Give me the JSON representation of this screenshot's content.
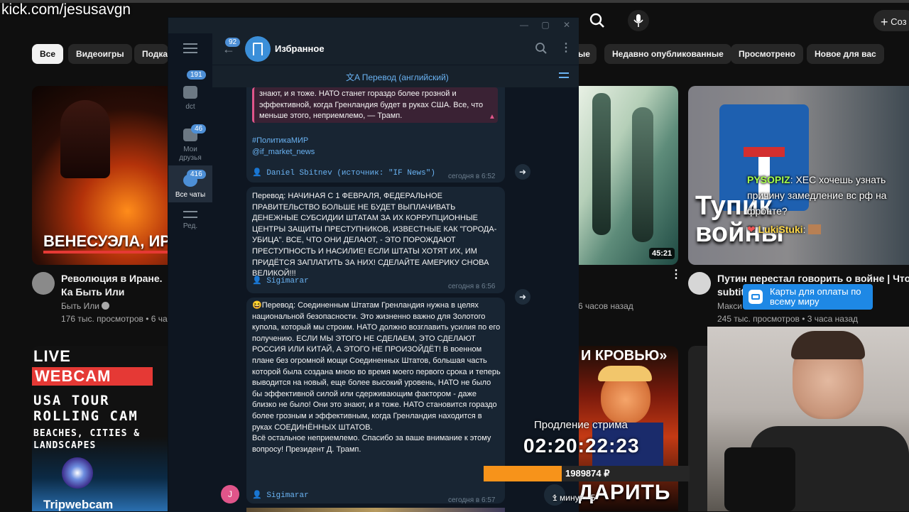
{
  "overlay": {
    "channel_url": "kick.com/jesusavgn",
    "stream_extension_label": "Продление стрима",
    "stream_timer": "02:20:22:23",
    "donation_amount": "1989874 ₽",
    "donation_progress_pct": 38,
    "bottom_timer_text": "1 минут - 5",
    "ad_text": "Карты для оплаты по всему миру",
    "chat": [
      {
        "user": "PYSOPIZ",
        "text": ": ХЕС хочешь узнать причину замедление вс рф на фронте?"
      },
      {
        "user": "LukiStuki",
        "text": ":"
      }
    ]
  },
  "youtube": {
    "create_label": "Соз",
    "chips": [
      "Все",
      "Видеоигры",
      "Подка",
      "ые",
      "Недавно опубликованные",
      "Просмотрено",
      "Новое для вас"
    ],
    "videos": [
      {
        "thumb_text": "ВЕНЕСУЭЛА, ИР",
        "title": "Революция в Иране. Ка Быть Или",
        "channel": "Быть Или",
        "meta": "176 тыс. просмотров • 6 ча"
      },
      {
        "thumb_text": "",
        "duration": "45:21",
        "title": "",
        "channel": "",
        "meta": "6 часов назад"
      },
      {
        "thumb_text": "Тупик войны",
        "title": "Путин перестал говорить о войне | Что слу",
        "channel": "Макси",
        "meta": "245 тыс. просмотров • 3 часа назад",
        "subtitle_fragment": "subtit"
      },
      {
        "thumb_text": "LIVE WEBCAM USA TOUR ROLLING CAM BEACHES, CITIES & LANDSCAPES Tripwebcam",
        "title": "",
        "channel": "",
        "meta": ""
      },
      {
        "thumb_text": "И КРОВЬЮ»",
        "bottom_text": "ДАРИТЬ",
        "title": "",
        "channel": "",
        "meta": ""
      }
    ],
    "live_badge": "LIVE",
    "webcam_label": "WEBCAM",
    "usa_tour": "USA TOUR",
    "rolling_cam": "ROLLING CAM",
    "beaches": "BEACHES, CITIES &",
    "landscapes": "LANDSCAPES",
    "tripwebcam": "Tripwebcam"
  },
  "telegram": {
    "back_count": "92",
    "chat_title": "Избранное",
    "translate_bar": "Перевод (английский)",
    "sidebar": [
      {
        "label": "dct",
        "badge": "191"
      },
      {
        "label": "Мои друзья",
        "badge": "46"
      },
      {
        "label": "Все чаты",
        "badge": "416"
      },
      {
        "label": "Ред.",
        "badge": ""
      }
    ],
    "messages": [
      {
        "quote": "знают, и я тоже. НАТО станет гораздо более грозной и эффективной, когда Гренландия будет в руках США. Все, что меньше этого, неприемлемо, — Трамп.",
        "hashtag": "#ПолитикаМИР",
        "mention": "@if_market_news",
        "author": "Daniel Sbitnev (источник: \"IF News\")",
        "time": "сегодня в 6:52"
      },
      {
        "text": "Перевод: НАЧИНАЯ С 1 ФЕВРАЛЯ, ФЕДЕРАЛЬНОЕ ПРАВИТЕЛЬСТВО БОЛЬШЕ НЕ БУДЕТ ВЫПЛАЧИВАТЬ ДЕНЕЖНЫЕ СУБСИДИИ ШТАТАМ ЗА ИХ КОРРУПЦИОННЫЕ ЦЕНТРЫ ЗАЩИТЫ ПРЕСТУПНИКОВ, ИЗВЕСТНЫЕ КАК \"ГОРОДА-УБИЦА\". ВСЕ, ЧТО ОНИ ДЕЛАЮТ, - ЭТО ПОРОЖДАЮТ ПРЕСТУПНОСТЬ И НАСИЛИЕ! ЕСЛИ ШТАТЫ ХОТЯТ ИХ, ИМ ПРИДЁТСЯ ЗАПЛАТИТЬ ЗА НИХ! СДЕЛАЙТЕ АМЕРИКУ СНОВА ВЕЛИКОЙ!!!",
        "author": "Sigimarar",
        "time": "сегодня в 6:56"
      },
      {
        "text": "😆Перевод: Соединенным Штатам Гренландия нужна в целях национальной безопасности. Это жизненно важно для Золотого купола, который мы строим. НАТО должно возглавить усилия по его получению. ЕСЛИ МЫ ЭТОГО НЕ СДЕЛАЕМ, ЭТО СДЕЛАЮТ РОССИЯ ИЛИ КИТАЙ, А ЭТОГО НЕ ПРОИЗОЙДЁТ! В военном плане без огромной мощи Соединенных Штатов, большая часть которой была создана мною во время моего первого срока и теперь выводится на новый, еще более высокий уровень, НАТО не было бы эффективной силой или сдерживающим фактором - даже близко не было! Они это знают, и я тоже. НАТО становится гораздо более грозным и эффективным, когда Гренландия находится в руках СОЕДИНЁННЫХ ШТАТОВ.\nВсё остальное неприемлемо. Спасибо за ваше внимание к этому вопросу! Президент Д. Трамп.",
        "author": "Sigimarar",
        "time": "сегодня в 6:57"
      }
    ],
    "avatar_letter": "J"
  },
  "colors": {
    "telegram_bg": "#0e1621",
    "telegram_msg": "#182533",
    "link": "#6ab3f3",
    "accent_orange": "#f7931a"
  }
}
